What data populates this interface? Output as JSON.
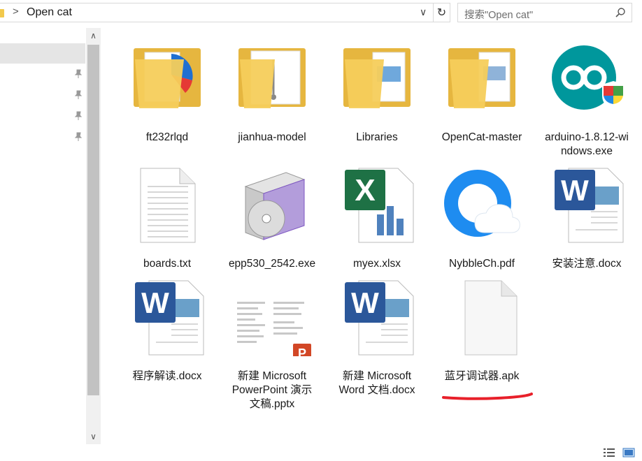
{
  "address": {
    "separator": ">",
    "path": "Open cat",
    "dropdown_glyph": "∨",
    "refresh_glyph": "↻"
  },
  "search": {
    "placeholder": "搜索\"Open cat\""
  },
  "scrollbar": {
    "up_glyph": "∧",
    "down_glyph": "∨"
  },
  "files": [
    {
      "name": "ft232rlqd",
      "icon": "folder-icon"
    },
    {
      "name": "jianhua-model",
      "icon": "folder-icon"
    },
    {
      "name": "Libraries",
      "icon": "folder-icon"
    },
    {
      "name": "OpenCat-master",
      "icon": "folder-icon"
    },
    {
      "name_lines": [
        "arduino-1.8.12-wi",
        "ndows.exe"
      ],
      "icon": "arduino-installer-icon"
    },
    {
      "name": "boards.txt",
      "icon": "text-file-icon"
    },
    {
      "name": "epp530_2542.exe",
      "icon": "installer-box-icon"
    },
    {
      "name": "myex.xlsx",
      "icon": "excel-file-icon"
    },
    {
      "name": "NybbleCh.pdf",
      "icon": "qq-browser-pdf-icon"
    },
    {
      "name": "安装注意.docx",
      "icon": "word-file-icon"
    },
    {
      "name": "程序解读.docx",
      "icon": "word-file-icon"
    },
    {
      "name_lines": [
        "新建 Microsoft",
        "PowerPoint 演示",
        "文稿.pptx"
      ],
      "icon": "powerpoint-file-icon"
    },
    {
      "name_lines": [
        "新建 Microsoft",
        "Word 文档.docx"
      ],
      "icon": "word-file-icon"
    },
    {
      "name": "蓝牙调试器.apk",
      "icon": "blank-file-icon"
    }
  ],
  "colors": {
    "folder": "#f2c94c",
    "arduino": "#00979c",
    "excel": "#1e7145",
    "word": "#2b579a",
    "powerpoint": "#d24726",
    "annotation": "#e8202a"
  }
}
